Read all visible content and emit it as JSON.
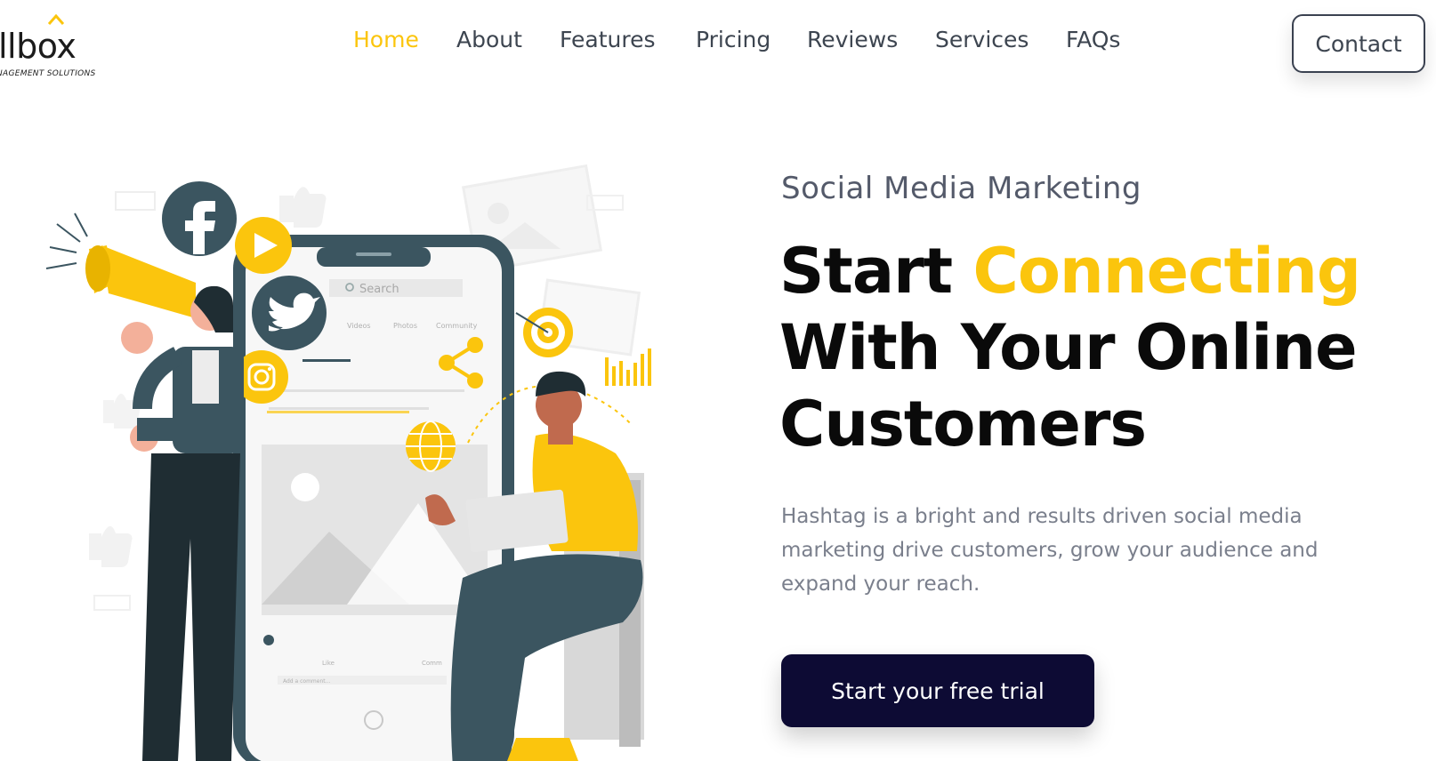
{
  "brand": {
    "name": "llbox",
    "tagline": "NAGEMENT SOLUTIONS"
  },
  "nav": {
    "items": [
      {
        "label": "Home",
        "active": true
      },
      {
        "label": "About"
      },
      {
        "label": "Features"
      },
      {
        "label": "Pricing"
      },
      {
        "label": "Reviews"
      },
      {
        "label": "Services"
      },
      {
        "label": "FAQs"
      }
    ],
    "contact_label": "Contact"
  },
  "hero": {
    "eyebrow": "Social Media Marketing",
    "headline_start": "Start ",
    "headline_highlight": "Connecting",
    "headline_rest": "With Your Online Customers",
    "lead": "Hashtag is a bright and results driven social media marketing drive customers, grow your audience and expand your reach.",
    "cta_label": "Start your free trial"
  },
  "illustration": {
    "search_placeholder": "Search",
    "profile_tabs": [
      "Videos",
      "Photos",
      "Community"
    ],
    "like_label": "Like",
    "comment_label": "Comm",
    "comment_placeholder": "Add a comment..."
  },
  "colors": {
    "accent": "#fbc50d",
    "dark_navy": "#0d0b34",
    "slate": "#3a5560",
    "nav_text": "#3d4550"
  }
}
